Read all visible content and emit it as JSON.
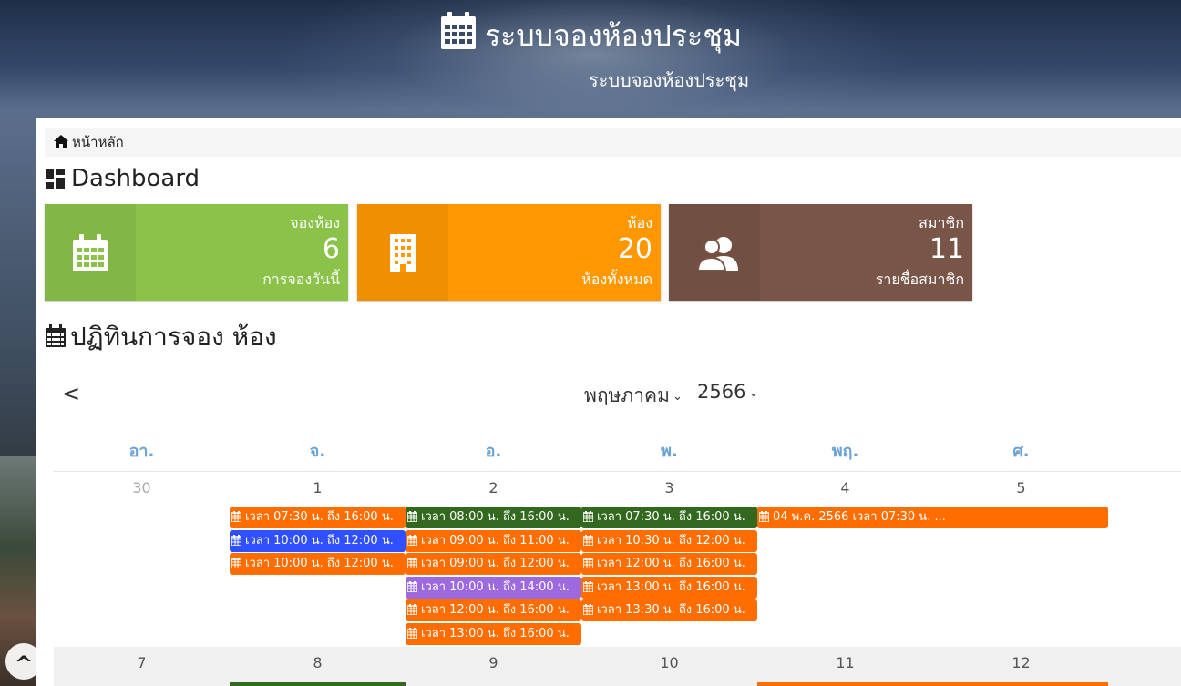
{
  "header": {
    "title": "ระบบจองห้องประชุม",
    "subtitle": "ระบบจองห้องประชุม"
  },
  "breadcrumb": {
    "home_label": "หน้าหลัก"
  },
  "dashboard": {
    "title": "Dashboard",
    "cards": [
      {
        "label": "จองห้อง",
        "value": "6",
        "caption": "การจองวันนี้",
        "color": "#8bc34a",
        "icon": "calendar-icon"
      },
      {
        "label": "ห้อง",
        "value": "20",
        "caption": "ห้องทั้งหมด",
        "color": "#ff9800",
        "icon": "building-icon"
      },
      {
        "label": "สมาชิก",
        "value": "11",
        "caption": "รายชื่อสมาชิก",
        "color": "#795548",
        "icon": "users-icon"
      }
    ]
  },
  "calendar": {
    "title": "ปฏิทินการจอง ห้อง",
    "prev_label": "<",
    "month": "พฤษภาคม",
    "year": "2566",
    "weekdays": [
      "อา.",
      "จ.",
      "อ.",
      "พ.",
      "พฤ.",
      "ศ."
    ],
    "week1": [
      "30",
      "1",
      "2",
      "3",
      "4",
      "5"
    ],
    "week2": [
      "7",
      "8",
      "9",
      "10",
      "11",
      "12"
    ],
    "events": {
      "mon1": [
        "เวลา 07:30 น. ถึง 16:00 น.",
        "เวลา 10:00 น. ถึง 12:00 น.",
        "เวลา 10:00 น. ถึง 12:00 น."
      ],
      "tue2": [
        "เวลา 08:00 น. ถึง 16:00 น.",
        "เวลา 09:00 น. ถึง 11:00 น.",
        "เวลา 09:00 น. ถึง 12:00 น.",
        "เวลา 10:00 น. ถึง 14:00 น.",
        "เวลา 12:00 น. ถึง 16:00 น.",
        "เวลา 13:00 น. ถึง 16:00 น."
      ],
      "wed3": [
        "เวลา 07:30 น. ถึง 16:00 น.",
        "เวลา 10:30 น. ถึง 12:00 น.",
        "เวลา 12:00 น. ถึง 16:00 น.",
        "เวลา 13:00 น. ถึง 16:00 น.",
        "เวลา 13:30 น. ถึง 16:00 น."
      ],
      "thu4": [
        "04 พ.ค. 2566 เวลา 07:30 น. ..."
      ]
    },
    "event_colors": {
      "orange": "#ff6d00",
      "blue": "#304ffe",
      "green": "#33691e",
      "purple": "#9c6ade"
    }
  },
  "scroll_top_label": "^"
}
